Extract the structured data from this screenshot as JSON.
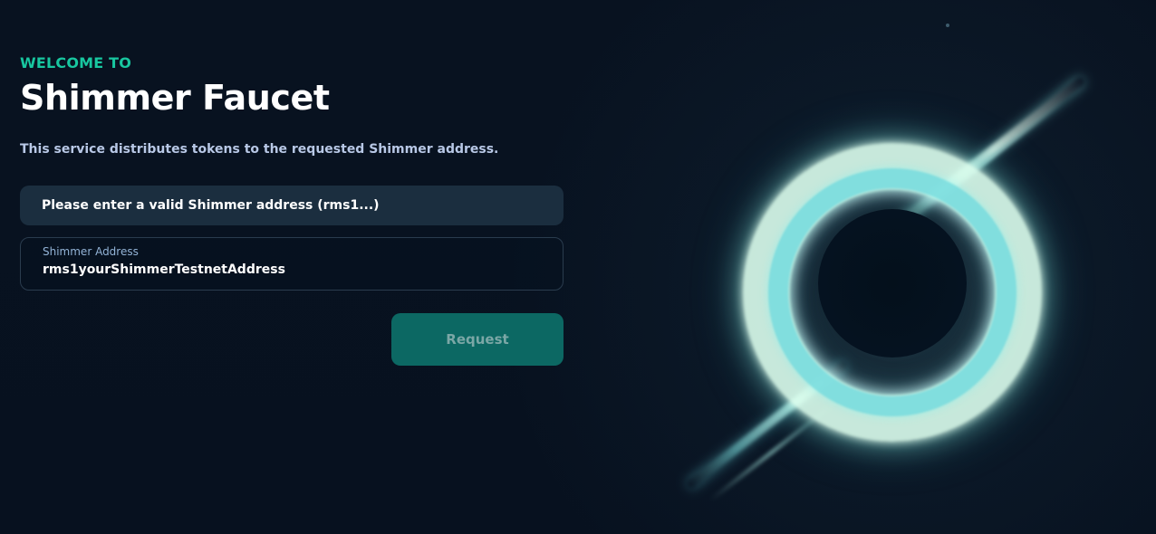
{
  "hero": {
    "eyebrow": "WELCOME TO",
    "title": "Shimmer Faucet",
    "description": "This service distributes tokens to the requested Shimmer address."
  },
  "form": {
    "notice": "Please enter a valid Shimmer address (rms1...)",
    "address_label": "Shimmer Address",
    "address_value": "rms1yourShimmerTestnetAddress",
    "request_label": "Request"
  },
  "icons": {
    "hero_art": "black-hole-icon"
  },
  "colors": {
    "background": "#07111f",
    "accent": "#18c7a0",
    "button": "#0c6863"
  }
}
